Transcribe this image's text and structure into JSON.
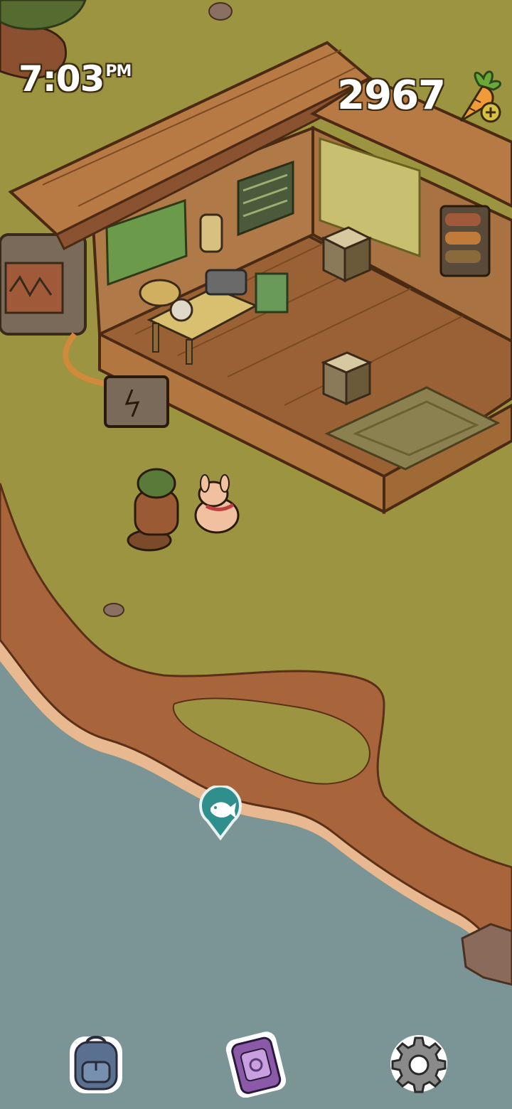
{
  "hud": {
    "time": "7:03",
    "ampm": "PM",
    "carrot_count": "2967"
  },
  "icons": {
    "currency": "carrot-icon",
    "add": "plus-icon",
    "fishing_spot": "fish-marker-icon",
    "backpack": "backpack-icon",
    "phone": "phone-icon",
    "settings": "gear-icon"
  },
  "colors": {
    "grass": "#9c9440",
    "water": "#7a9394",
    "cliff": "#a8643a",
    "wood": "#b87a44",
    "marker": "#2f8f8c"
  }
}
